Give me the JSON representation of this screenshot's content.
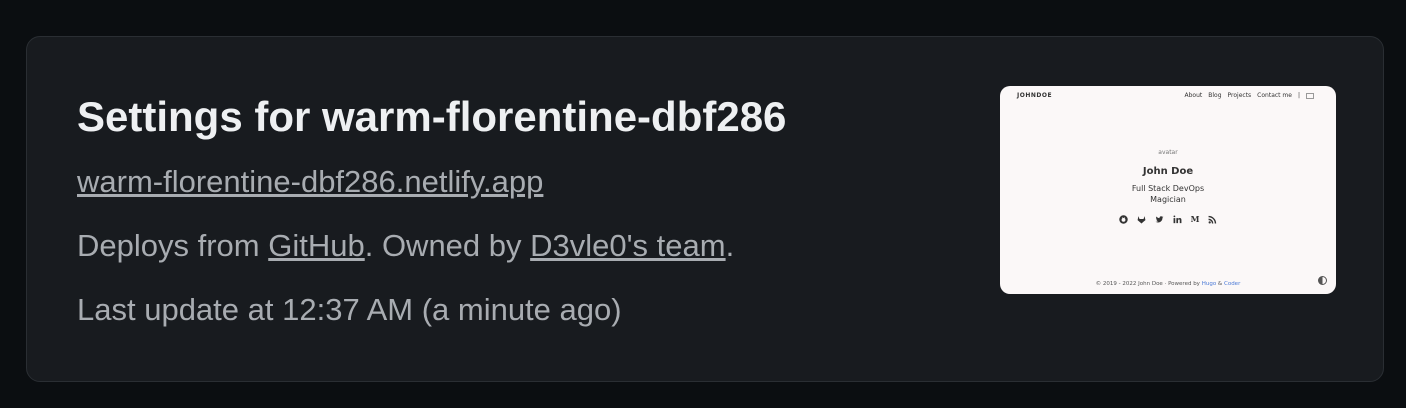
{
  "settings": {
    "title": "Settings for warm-florentine-dbf286",
    "site_url": "warm-florentine-dbf286.netlify.app",
    "deploys_prefix": "Deploys from ",
    "deploys_source": "GitHub",
    "owned_prefix": ". Owned by ",
    "owner": "D3vle0's team",
    "owned_suffix": ".",
    "last_update": "Last update at 12:37 AM (a minute ago)"
  },
  "preview": {
    "brand": "JOHNDOE",
    "nav": [
      "About",
      "Blog",
      "Projects",
      "Contact me",
      "|"
    ],
    "avatar_alt": "avatar",
    "name": "John Doe",
    "subtitle_line1": "Full Stack DevOps",
    "subtitle_line2": "Magician",
    "social_icons": [
      "github-icon",
      "gitlab-icon",
      "twitter-icon",
      "linkedin-icon",
      "medium-icon",
      "rss-icon"
    ],
    "footer_text": "© 2019 - 2022 John Doe · Powered by ",
    "footer_hugo": "Hugo",
    "footer_amp": " & ",
    "footer_coder": "Coder"
  },
  "colors": {
    "background": "#0b0e11",
    "card": "#181b1f",
    "text_primary": "#eef0f2",
    "text_secondary": "#a8acb1",
    "preview_bg": "#fbf8f8"
  }
}
